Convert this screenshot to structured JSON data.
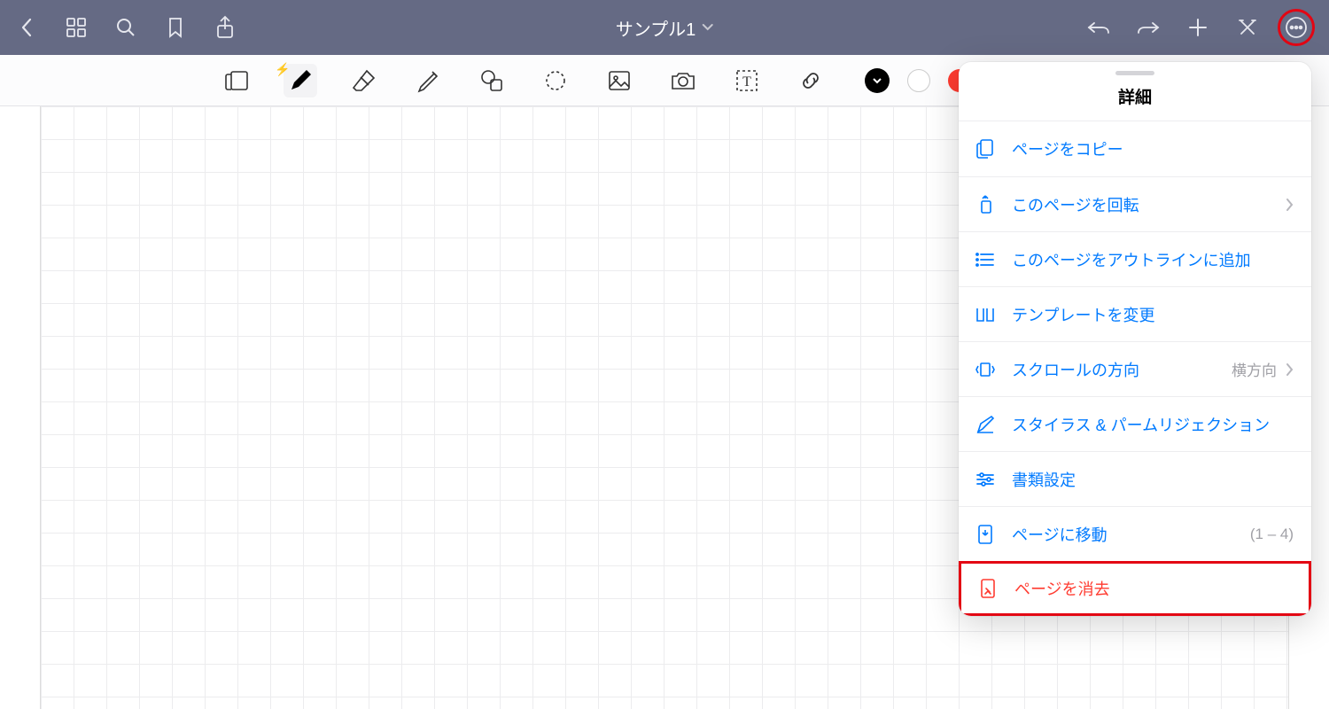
{
  "header": {
    "title": "サンプル1"
  },
  "popover": {
    "title": "詳細",
    "items": {
      "copy": "ページをコピー",
      "rotate": "このページを回転",
      "outline": "このページをアウトラインに追加",
      "template": "テンプレートを変更",
      "scroll": "スクロールの方向",
      "scroll_value": "横方向",
      "stylus": "スタイラス & パームリジェクション",
      "docset": "書類設定",
      "goto": "ページに移動",
      "goto_value": "(1 – 4)",
      "clear": "ページを消去"
    }
  },
  "colors": {
    "white": "#ffffff",
    "red": "#ff3b30"
  }
}
